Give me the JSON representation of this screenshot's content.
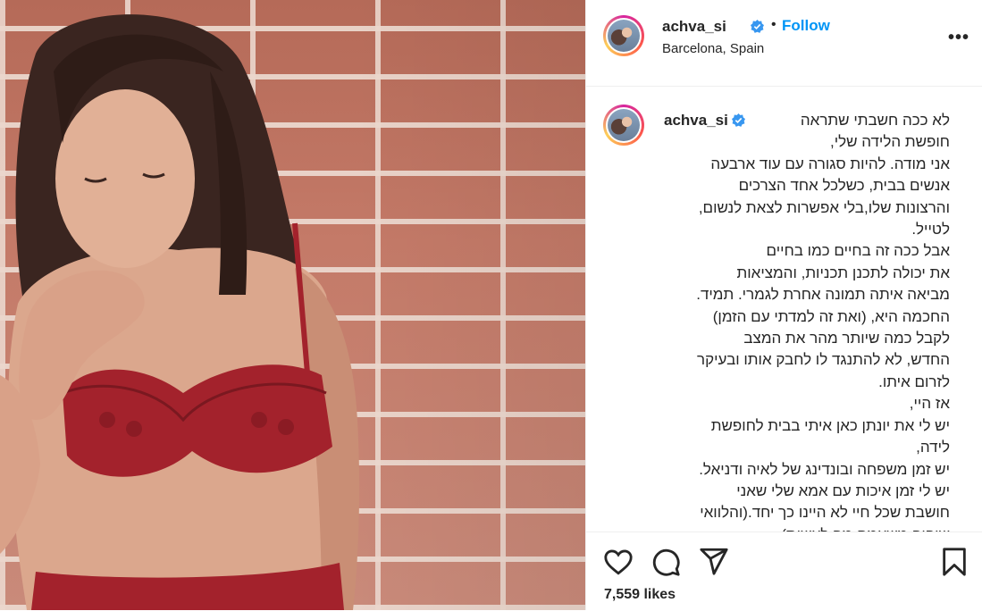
{
  "post": {
    "username": "achva_si",
    "verified": true,
    "follow_label": "Follow",
    "separator": "•",
    "location": "Barcelona, Spain",
    "more_label": "•••",
    "likes": "7,559 likes"
  },
  "caption": {
    "username": "achva_si",
    "first_line": "לא ככה חשבתי שתראה",
    "lines": [
      "חופשת הלידה שלי,",
      "אני מודה. להיות סגורה עם עוד ארבעה",
      "אנשים בבית, כשלכל אחד הצרכים",
      "והרצונות שלו,בלי אפשרות לצאת לנשום,",
      "לטייל.",
      "אבל ככה זה בחיים כמו בחיים",
      "את יכולה לתכנן תכניות, והמציאות",
      "מביאה איתה תמונה אחרת לגמרי. תמיד.",
      "החכמה היא, (ואת זה למדתי עם הזמן)",
      "לקבל כמה שיותר מהר את המצב",
      "החדש, לא להתנגד לו לחבק אותו ובעיקר",
      "לזרום איתו.",
      "אז היי,",
      "יש לי את יונתן כאן איתי בבית לחופשת",
      "לידה,",
      "יש זמן משפחה ובונדינג של לאיה ודניאל.",
      "יש לי זמן איכות עם אמא שלי שאני",
      "חושבת שכל חיי לא היינו כך יחד.(והלוואי",
      "שיהיה משעמם מה לעשות)"
    ]
  },
  "icons": {
    "like": "heart-icon",
    "comment": "comment-icon",
    "share": "share-icon",
    "save": "bookmark-icon",
    "verified": "verified-badge-icon"
  },
  "colors": {
    "follow": "#0095f6",
    "text": "#262626",
    "divider": "#efefef"
  }
}
